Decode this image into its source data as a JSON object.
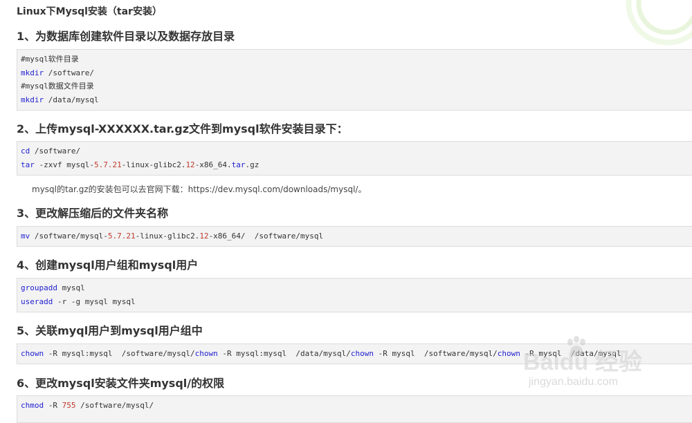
{
  "page_title": "Linux下Mysql安装（tar安装）",
  "sections": [
    {
      "heading": "1、为数据库创建软件目录以及数据存放目录",
      "lines": [
        [
          {
            "t": "#mysql软件目录",
            "c": ""
          }
        ],
        [
          {
            "t": "mkdir",
            "c": "kw"
          },
          {
            "t": " /software/",
            "c": ""
          }
        ],
        [
          {
            "t": "#mysql数据文件目录",
            "c": ""
          }
        ],
        [
          {
            "t": "mkdir",
            "c": "kw"
          },
          {
            "t": " /data/mysql",
            "c": ""
          }
        ]
      ]
    },
    {
      "heading": "2、上传mysql-XXXXXX.tar.gz文件到mysql软件安装目录下：",
      "lines": [
        [
          {
            "t": "cd",
            "c": "kw"
          },
          {
            "t": " /software/",
            "c": ""
          }
        ],
        [
          {
            "t": "tar",
            "c": "kw"
          },
          {
            "t": " -zxvf mysql-",
            "c": ""
          },
          {
            "t": "5.7.21",
            "c": "num"
          },
          {
            "t": "-linux-glibc2.",
            "c": ""
          },
          {
            "t": "12",
            "c": "num"
          },
          {
            "t": "-x86_64.",
            "c": ""
          },
          {
            "t": "tar",
            "c": "kw"
          },
          {
            "t": ".gz",
            "c": ""
          }
        ]
      ],
      "note": "mysql的tar.gz的安装包可以去官网下载：https://dev.mysql.com/downloads/mysql/。"
    },
    {
      "heading": "3、更改解压缩后的文件夹名称",
      "lines": [
        [
          {
            "t": "mv",
            "c": "kw"
          },
          {
            "t": " /software/mysql-",
            "c": ""
          },
          {
            "t": "5.7.21",
            "c": "num"
          },
          {
            "t": "-linux-glibc2.",
            "c": ""
          },
          {
            "t": "12",
            "c": "num"
          },
          {
            "t": "-x86_64/  /software/mysql",
            "c": ""
          }
        ]
      ]
    },
    {
      "heading": "4、创建mysql用户组和mysql用户",
      "lines": [
        [
          {
            "t": "groupadd",
            "c": "kw"
          },
          {
            "t": " mysql",
            "c": ""
          }
        ],
        [
          {
            "t": "useradd",
            "c": "kw"
          },
          {
            "t": " -r -g mysql mysql",
            "c": ""
          }
        ]
      ]
    },
    {
      "heading": "5、关联myql用户到mysql用户组中",
      "lines": [
        [
          {
            "t": "chown",
            "c": "kw"
          },
          {
            "t": " -R mysql:mysql  /software/mysql/",
            "c": ""
          },
          {
            "t": "chown",
            "c": "kw"
          },
          {
            "t": " -R mysql:mysql  /data/mysql/",
            "c": ""
          },
          {
            "t": "chown",
            "c": "kw"
          },
          {
            "t": " -R mysql  /software/mysql/",
            "c": ""
          },
          {
            "t": "chown",
            "c": "kw"
          },
          {
            "t": " -R mysql  /data/mysql",
            "c": ""
          }
        ]
      ]
    },
    {
      "heading": "6、更改mysql安装文件夹mysql/的权限",
      "lines": [
        [
          {
            "t": "chmod",
            "c": "kw"
          },
          {
            "t": " -R ",
            "c": ""
          },
          {
            "t": "755",
            "c": "num"
          },
          {
            "t": " /software/mysql/",
            "c": ""
          }
        ]
      ]
    }
  ],
  "watermark": {
    "brand": "Baidu 经验",
    "domain": "jingyan.baidu.com"
  },
  "colors": {
    "keyword": "#1e1ed0",
    "number": "#c0392b",
    "code_bg": "#f3f3f3"
  }
}
